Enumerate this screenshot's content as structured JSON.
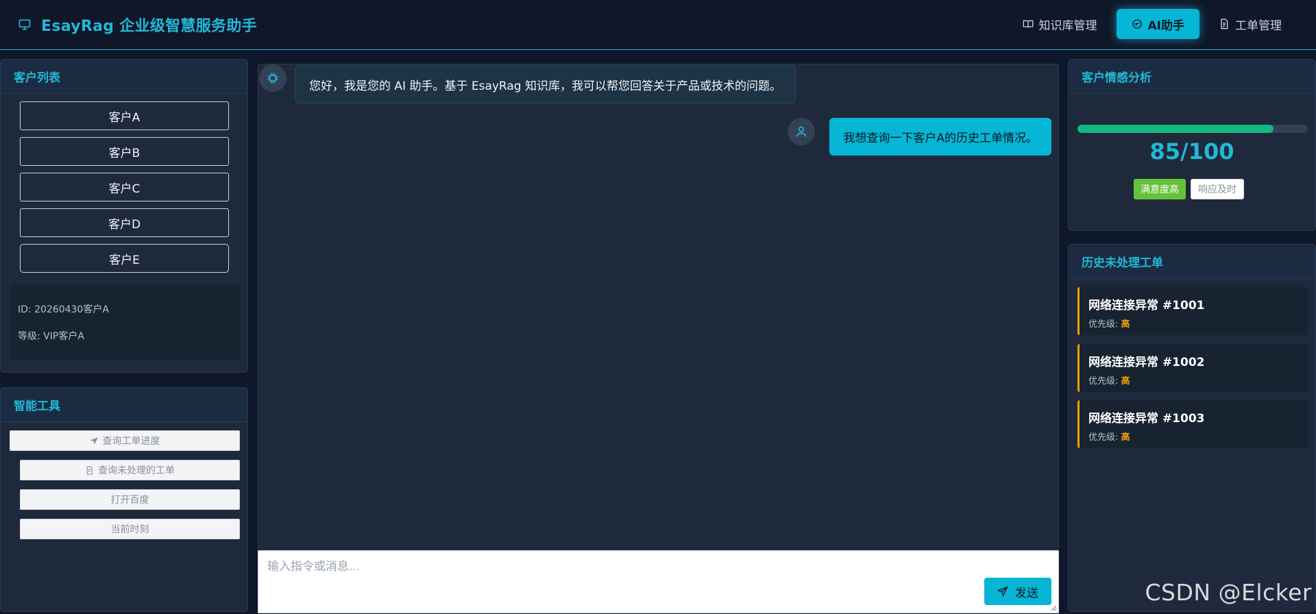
{
  "header": {
    "brand_title": "EsayRag 企业级智慧服务助手",
    "nav": [
      {
        "label": "知识库管理",
        "icon": "book-open-icon"
      },
      {
        "label": "AI助手",
        "icon": "chat-bubble-icon",
        "active": true
      },
      {
        "label": "工单管理",
        "icon": "document-icon"
      }
    ]
  },
  "customers": {
    "title": "客户列表",
    "items": [
      "客户A",
      "客户B",
      "客户C",
      "客户D",
      "客户E"
    ],
    "info": {
      "id": "ID: 20260430客户A",
      "level": "等级: VIP客户A"
    }
  },
  "tools": {
    "title": "智能工具",
    "items": [
      {
        "label": "查询工单进度",
        "icon": "send-icon"
      },
      {
        "label": "查询未处理的工单",
        "icon": "document-icon"
      },
      {
        "label": "打开百度",
        "icon": ""
      },
      {
        "label": "当前时刻",
        "icon": ""
      }
    ]
  },
  "chat": {
    "messages": [
      {
        "role": "ai",
        "text": "您好，我是您的 AI 助手。基于 EsayRag 知识库，我可以帮您回答关于产品或技术的问题。"
      },
      {
        "role": "user",
        "text": "我想查询一下客户A的历史工单情况。"
      }
    ],
    "input_placeholder": "输入指令或消息...",
    "send_label": "发送"
  },
  "sentiment": {
    "title": "客户情感分析",
    "score": 85,
    "max": 100,
    "score_text": "85/100",
    "tags": [
      "满意度高",
      "响应及时"
    ]
  },
  "tickets": {
    "title": "历史未处理工单",
    "priority_label": "优先级: ",
    "items": [
      {
        "title": "网络连接异常 #1001",
        "priority": "高"
      },
      {
        "title": "网络连接异常 #1002",
        "priority": "高"
      },
      {
        "title": "网络连接异常 #1003",
        "priority": "高"
      }
    ]
  },
  "watermark": "CSDN @Elcker",
  "colors": {
    "accent": "#22b8d6",
    "active_nav": "#06b6d4",
    "progress": "#10b981",
    "tag_green": "#67c23a",
    "priority": "#f59e0b"
  }
}
